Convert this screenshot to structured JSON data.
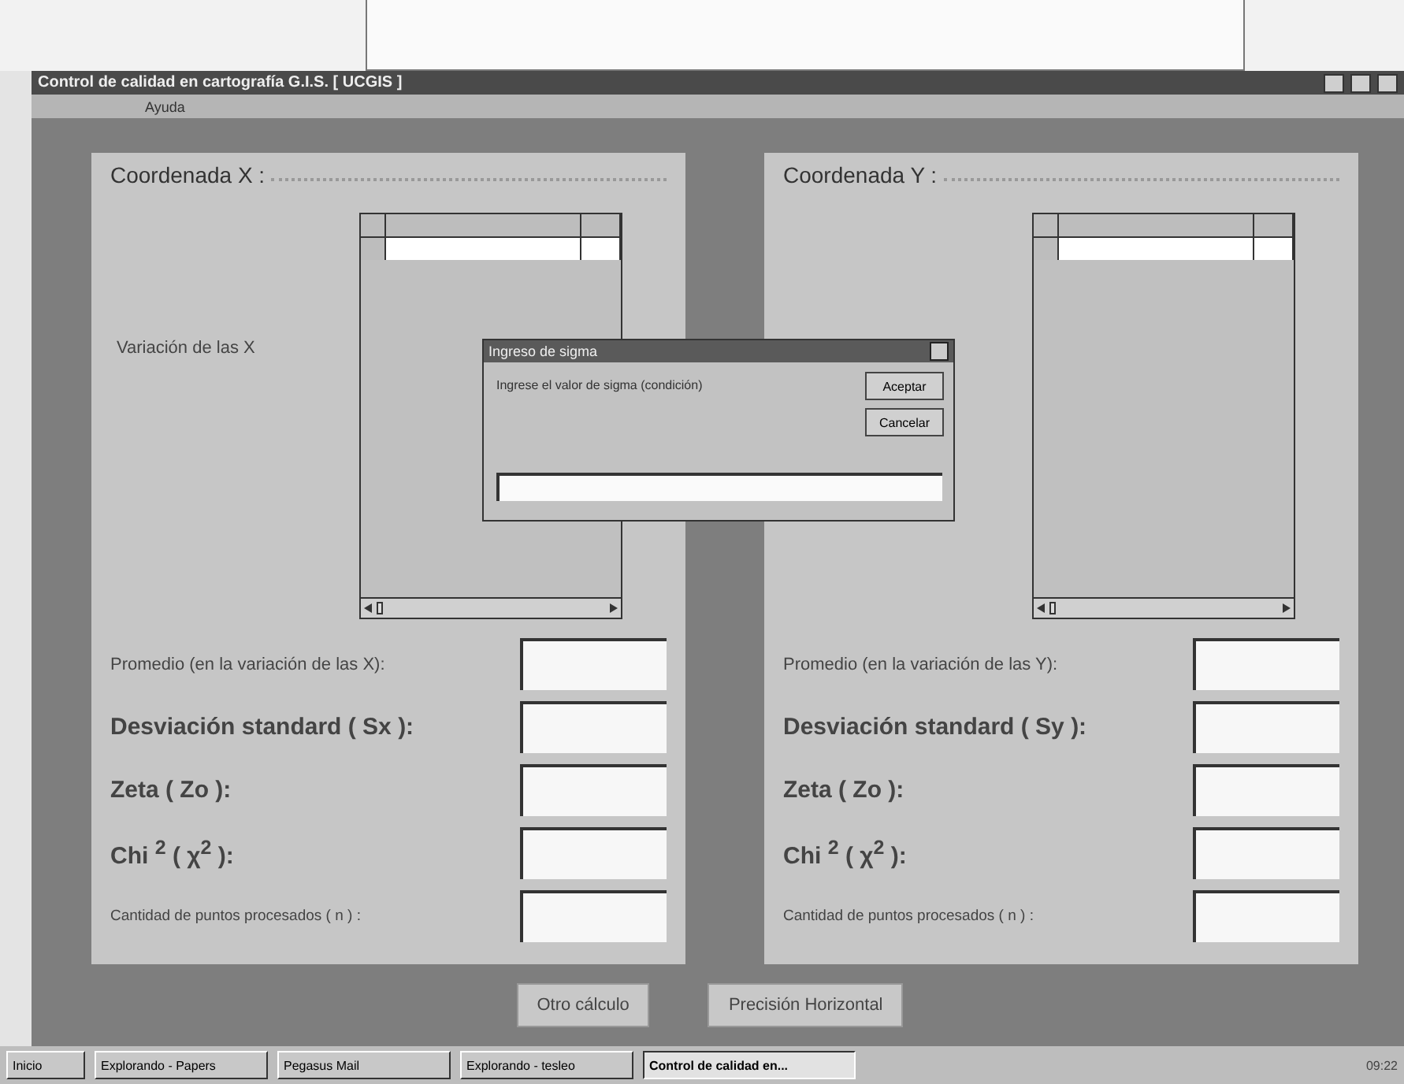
{
  "window": {
    "title": "Control de calidad en cartografía G.I.S. [ UCGIS ]"
  },
  "menu": [
    {
      "label": "Ayuda"
    }
  ],
  "panels": [
    {
      "title": "Coordenada X :",
      "grid_label": "Variación de las X",
      "fields": [
        {
          "label": "Promedio (en la variación de las X):",
          "kind": "small"
        },
        {
          "label": "Desviación standard ( Sx ):",
          "kind": "large"
        },
        {
          "label": "Zeta ( Zo ):",
          "kind": "large"
        },
        {
          "label": "Chi $^{2}$ ( χ$^{2}$ ):",
          "kind": "large"
        },
        {
          "label": "Cantidad de puntos procesados  ( n ) :",
          "kind": "tiny"
        }
      ]
    },
    {
      "title": "Coordenada Y :",
      "fields": [
        {
          "label": "Promedio (en la variación de las Y):",
          "kind": "small"
        },
        {
          "label": "Desviación standard ( Sy ):",
          "kind": "large"
        },
        {
          "label": "Zeta ( Zo ):",
          "kind": "large"
        },
        {
          "label": "Chi $^{2}$ ( χ$^{2}$ ):",
          "kind": "large"
        },
        {
          "label": "Cantidad de puntos procesados  ( n ) :",
          "kind": "tiny"
        }
      ]
    }
  ],
  "buttons": [
    {
      "label": "Otro cálculo"
    },
    {
      "label": "Precisión Horizontal"
    }
  ],
  "dialog": {
    "title": "Ingreso de sigma",
    "message": "Ingrese el valor de sigma (condición)",
    "buttons": [
      {
        "label": "Aceptar"
      },
      {
        "label": "Cancelar"
      }
    ]
  },
  "taskbar": {
    "start": "Inicio",
    "items": [
      {
        "label": "Explorando - Papers",
        "selected": false
      },
      {
        "label": "Pegasus Mail",
        "selected": false
      },
      {
        "label": "Explorando - tesleo",
        "selected": false
      },
      {
        "label": "Control de calidad en...",
        "selected": true
      }
    ],
    "clock": "09:22"
  }
}
